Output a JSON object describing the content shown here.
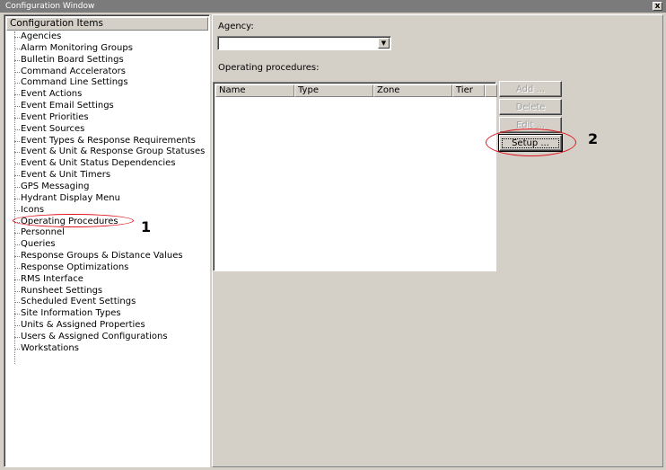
{
  "window": {
    "title": "Configuration Window",
    "close_symbol": "x"
  },
  "tree": {
    "header": "Configuration Items",
    "items": [
      "Agencies",
      "Alarm Monitoring Groups",
      "Bulletin Board Settings",
      "Command Accelerators",
      "Command Line Settings",
      "Event Actions",
      "Event Email Settings",
      "Event Priorities",
      "Event Sources",
      "Event Types & Response Requirements",
      "Event & Unit & Response Group Statuses",
      "Event & Unit Status Dependencies",
      "Event & Unit Timers",
      "GPS Messaging",
      "Hydrant Display Menu",
      "Icons",
      "Operating Procedures",
      "Personnel",
      "Queries",
      "Response Groups & Distance Values",
      "Response Optimizations",
      "RMS Interface",
      "Runsheet Settings",
      "Scheduled Event Settings",
      "Site Information Types",
      "Units & Assigned Properties",
      "Users & Assigned Configurations",
      "Workstations"
    ]
  },
  "form": {
    "agency_label": "Agency:",
    "agency_value": "",
    "procedures_label": "Operating procedures:",
    "columns": [
      "Name",
      "Type",
      "Zone",
      "Tier"
    ]
  },
  "buttons": {
    "add": "Add ...",
    "delete": "Delete",
    "edit": "Edit ...",
    "setup": "Setup ..."
  },
  "annotations": {
    "marker1": "1",
    "marker2": "2",
    "color": "#e0141e"
  },
  "icons": {
    "dropdown": "chevron-down-icon",
    "close": "close-icon"
  }
}
